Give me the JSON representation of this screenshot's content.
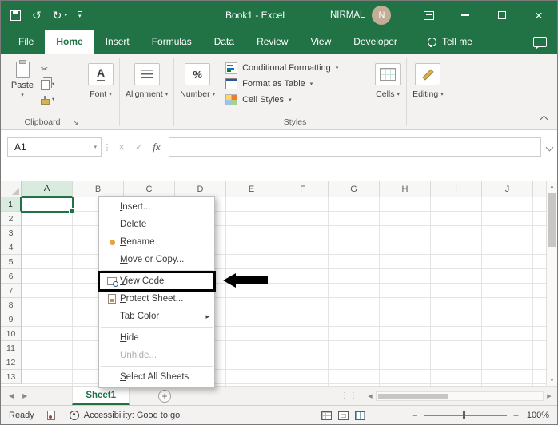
{
  "colors": {
    "excel_green": "#217346"
  },
  "titlebar": {
    "title": "Book1 - Excel",
    "user": "NIRMAL",
    "avatar_initial": "N"
  },
  "tabs": {
    "items": [
      {
        "label": "File",
        "file": true
      },
      {
        "label": "Home",
        "active": true
      },
      {
        "label": "Insert"
      },
      {
        "label": "Formulas"
      },
      {
        "label": "Data"
      },
      {
        "label": "Review"
      },
      {
        "label": "View"
      },
      {
        "label": "Developer"
      }
    ],
    "tell_me": "Tell me"
  },
  "ribbon": {
    "paste_label": "Paste",
    "font_label": "Font",
    "alignment_label": "Alignment",
    "number_label": "Number",
    "styles_buttons": [
      "Conditional Formatting",
      "Format as Table",
      "Cell Styles"
    ],
    "cells_label": "Cells",
    "editing_label": "Editing",
    "clipboard_group_label": "Clipboard",
    "styles_group_label": "Styles"
  },
  "formula_bar": {
    "name_box": "A1",
    "fx_label": "fx"
  },
  "grid": {
    "columns": [
      "A",
      "B",
      "C",
      "D",
      "E",
      "F",
      "G",
      "H",
      "I",
      "J"
    ],
    "rows": [
      "1",
      "2",
      "3",
      "4",
      "5",
      "6",
      "7",
      "8",
      "9",
      "10",
      "11",
      "12",
      "13"
    ],
    "selected_cell": "A1"
  },
  "context_menu": {
    "items": [
      {
        "label": "Insert...",
        "key": "I"
      },
      {
        "label": "Delete",
        "key": "D"
      },
      {
        "label": "Rename",
        "key": "R",
        "icon": "rename"
      },
      {
        "label": "Move or Copy...",
        "key": "M",
        "sep_after": true
      },
      {
        "label": "View Code",
        "key": "V",
        "icon": "view-code",
        "highlight": true
      },
      {
        "label": "Protect Sheet...",
        "key": "P",
        "icon": "protect-sheet"
      },
      {
        "label": "Tab Color",
        "key": "T",
        "submenu": true,
        "sep_after": true
      },
      {
        "label": "Hide",
        "key": "H"
      },
      {
        "label": "Unhide...",
        "key": "U",
        "disabled": true,
        "sep_after": true
      },
      {
        "label": "Select All Sheets",
        "key": "S"
      }
    ]
  },
  "sheet_bar": {
    "active_tab": "Sheet1",
    "add_label": "+"
  },
  "status_bar": {
    "mode": "Ready",
    "accessibility": "Accessibility: Good to go",
    "zoom_level": "100%"
  }
}
